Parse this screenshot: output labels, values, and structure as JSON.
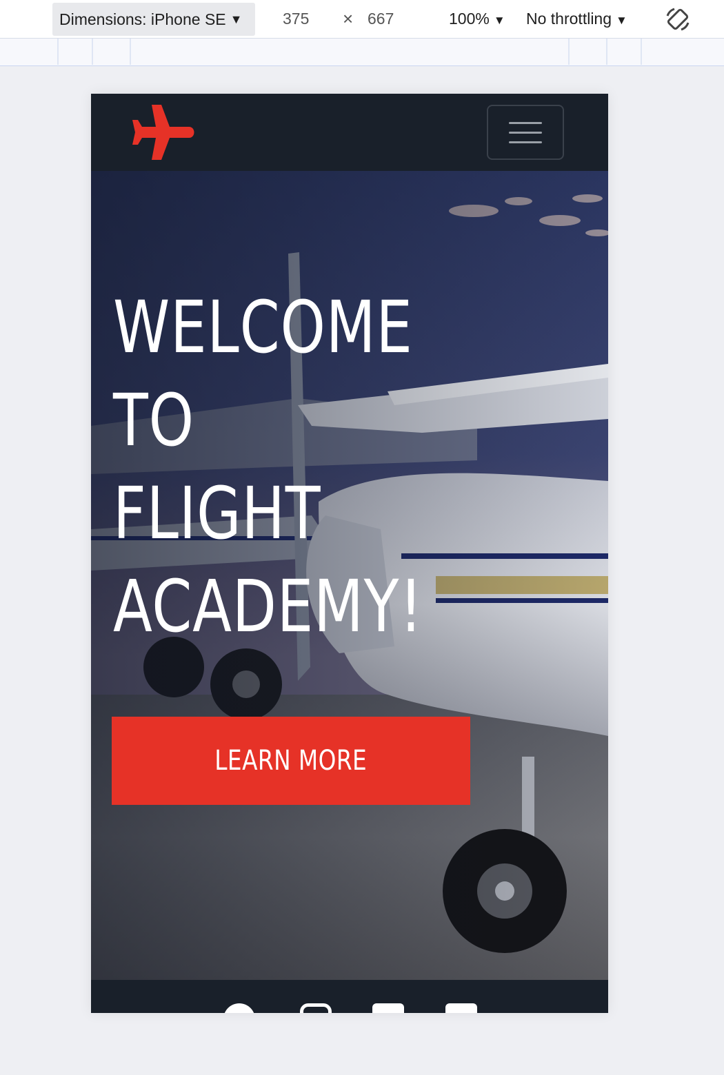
{
  "devtools": {
    "device_label": "Dimensions: iPhone SE",
    "width": "375",
    "times": "×",
    "height": "667",
    "zoom": "100%",
    "throttling": "No throttling"
  },
  "site": {
    "hero": {
      "title_lines": [
        "WELCOME",
        "TO",
        "FLIGHT",
        "ACADEMY!"
      ],
      "cta_label": "LEARN MORE"
    },
    "social": [
      "facebook-icon",
      "instagram-icon",
      "twitter-icon",
      "youtube-icon"
    ],
    "colors": {
      "brand_red": "#e63227",
      "nav_bg": "#19202a",
      "text_white": "#ffffff"
    }
  }
}
